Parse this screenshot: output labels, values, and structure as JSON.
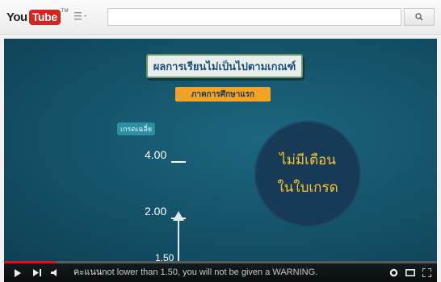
{
  "header": {
    "logo_you": "You",
    "logo_tube": "Tube",
    "logo_tm": "TM",
    "guide_icon": "guide-menu-icon",
    "search_value": "",
    "search_placeholder": "",
    "search_icon": "search-icon"
  },
  "video": {
    "title": "ผลการเรียนไม่เป็นไปตามเกณฑ์",
    "subtitle": "ภาคการศึกษาแรก",
    "axis_label": "เกรดเฉลี่ย",
    "ticks": [
      {
        "label": "4.00"
      },
      {
        "label": "2.00"
      },
      {
        "label": "1.50"
      }
    ],
    "circle_line1": "ไม่มีเตือน",
    "circle_line2": "ในใบเกรด",
    "colors": {
      "background": "#145268",
      "circle": "#173a57",
      "circle_text": "#f7c42e",
      "subtitle_bg": "#f4a223"
    }
  },
  "player": {
    "progress": 0.12,
    "caption": "not lower than 1.50, you will not be given a WARNING.",
    "caption_prefix": "คะแนน",
    "controls": [
      "play-icon",
      "next-icon",
      "volume-icon",
      "settings-icon",
      "miniplayer-icon",
      "fullscreen-icon"
    ]
  }
}
